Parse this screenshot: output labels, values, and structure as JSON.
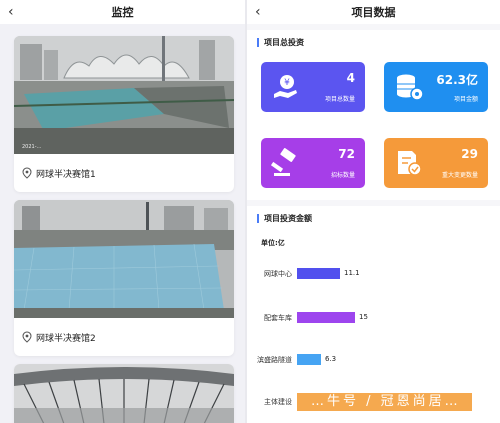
{
  "left": {
    "back_glyph": "‹",
    "title": "监控",
    "cameras": [
      {
        "caption": "网球半决赛馆1",
        "timestamp": "2021-…",
        "icon": "location-pin-icon"
      },
      {
        "caption": "网球半决赛馆2",
        "icon": "location-pin-icon"
      },
      {
        "caption": ""
      }
    ]
  },
  "right": {
    "back_glyph": "‹",
    "title": "项目数据",
    "investment": {
      "section_title": "项目总投资",
      "stats": [
        {
          "value": "4",
          "label": "项目总数量",
          "color": "#5b55f0",
          "icon": "money-hand-icon"
        },
        {
          "value": "62.3亿",
          "label": "项目金额",
          "color": "#1f8ff0",
          "icon": "database-gear-icon"
        },
        {
          "value": "72",
          "label": "招标数量",
          "color": "#a63ee8",
          "icon": "gavel-icon"
        },
        {
          "value": "29",
          "label": "重大变更数量",
          "color": "#f59a3a",
          "icon": "document-check-icon"
        }
      ]
    },
    "amount": {
      "section_title": "项目投资金额",
      "unit": "单位:亿",
      "bars": [
        {
          "label": "网球中心",
          "value": 11.1,
          "display": "11.1",
          "color": "#5150ee"
        },
        {
          "label": "配套车库",
          "value": 15,
          "display": "15",
          "color": "#9d45ee"
        },
        {
          "label": "滨盛路隧道",
          "value": 6.3,
          "display": "6.3",
          "color": "#46a4f3"
        },
        {
          "label": "主体建设",
          "value": 3.4,
          "display": "3.",
          "color": "#f5a04a"
        }
      ],
      "max": 15,
      "overlay_text": "…牛号 / 冠恩尚居…"
    }
  }
}
